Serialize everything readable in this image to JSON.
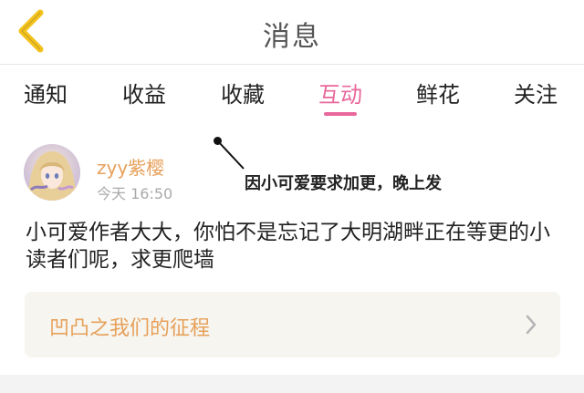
{
  "header": {
    "title": "消息",
    "back_icon": "chevron-left-icon"
  },
  "tabs": [
    {
      "label": "通知",
      "active": false
    },
    {
      "label": "收益",
      "active": false
    },
    {
      "label": "收藏",
      "active": false
    },
    {
      "label": "互动",
      "active": true
    },
    {
      "label": "鲜花",
      "active": false
    },
    {
      "label": "关注",
      "active": false
    }
  ],
  "message": {
    "username": "zyy紫樱",
    "time": "今天 16:50",
    "annotation": "因小可爱要求加更，晚上发",
    "text": "小可爱作者大大，你怕不是忘记了大明湖畔正在等更的小读者们呢，求更爬墙"
  },
  "work_card": {
    "title": "凹凸之我们的征程",
    "chevron_icon": "chevron-right-icon"
  },
  "colors": {
    "accent_pink": "#e9679c",
    "accent_orange": "#e7a05a",
    "back_yellow": "#f3c21d",
    "card_bg": "#f6f5ef"
  }
}
